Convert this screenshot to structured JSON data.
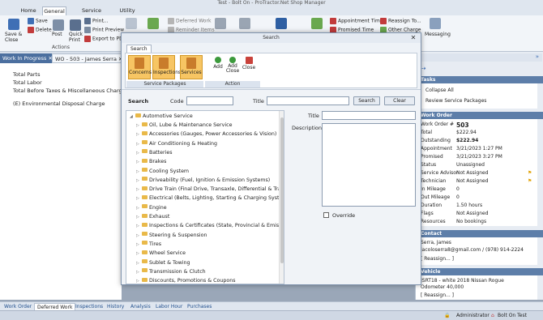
{
  "window": {
    "title": "Test - Bolt On - ProTractor.Net Shop Manager"
  },
  "ribbon": {
    "tabs": [
      "Home",
      "General",
      "Service Package",
      "Utility"
    ],
    "active_tab": "General",
    "items": {
      "save": "Save",
      "delete": "Delete",
      "save_close": "Save &\nClose",
      "post": "Post",
      "quick_print": "Quick\nPrint",
      "print": "Print...",
      "print_preview": "Print Preview",
      "export_pdf": "Export to PDF",
      "deferred_work": "Deferred Work",
      "reminder_items": "Reminder Items",
      "appointment_time": "Appointment Time",
      "promised_time": "Promised Time",
      "reassign_to": "Reassign To...",
      "other_charge": "Other Charge",
      "messaging": "Messaging"
    },
    "group_label": "Actions"
  },
  "doc_tabs": [
    "Work In Progress",
    "WO - 503 - James Serra"
  ],
  "left_panel": {
    "lines": [
      "Total Parts",
      "Total Labor",
      "Total Before Taxes & Miscellaneous Charges",
      "(E) Environmental Disposal Charge"
    ]
  },
  "right_panel": {
    "tasks_header": "Tasks",
    "tasks": [
      "Collapse All",
      "Review Service Packages"
    ],
    "work_order_header": "Work Order",
    "work_order": [
      {
        "label": "Work Order #",
        "value": "503"
      },
      {
        "label": "Total",
        "value": "$222.94"
      },
      {
        "label": "Outstanding",
        "value": "$222.94"
      },
      {
        "label": "Appointment",
        "value": "3/21/2023 1:27 PM"
      },
      {
        "label": "Promised",
        "value": "3/21/2023 3:27 PM"
      },
      {
        "label": "Status",
        "value": "Unassigned"
      },
      {
        "label": "Service Advisor",
        "value": "Not Assigned"
      },
      {
        "label": "Technician",
        "value": "Not Assigned"
      },
      {
        "label": "In Mileage",
        "value": "0"
      },
      {
        "label": "Out Mileage",
        "value": "0"
      },
      {
        "label": "Duration",
        "value": "1.50 hours"
      },
      {
        "label": "Flags",
        "value": "Not Assigned"
      },
      {
        "label": "Resources",
        "value": "No bookings"
      }
    ],
    "contact_header": "Contact",
    "contact_name": "Serra, James",
    "contact_info": "jacoloserra8@gmail.com / (978) 914-2224",
    "contact_reassign": "[ Reassign... ]",
    "vehicle_header": "Vehicle",
    "vehicle_desc": "JSRT18 - white 2018 Nissan Rogue",
    "vehicle_odo": "Odometer 40,000",
    "vehicle_reassign": "[ Reassign... ]"
  },
  "bottom_tabs": [
    "Work Order",
    "Deferred Work",
    "Inspections",
    "History",
    "Analysis",
    "Labor Hour",
    "Purchases"
  ],
  "status_bar": {
    "user": "Administrator",
    "shop": "Bolt On Test"
  },
  "modal": {
    "title": "Search",
    "ribbon_tab": "Search",
    "packages_buttons": [
      "Concerns",
      "Inspections",
      "Services"
    ],
    "packages_label": "Service Packages",
    "action_buttons": [
      "Add",
      "Add\nClose",
      "Close"
    ],
    "action_label": "Action",
    "search_label": "Search",
    "code_label": "Code",
    "code_value": "",
    "title_label": "Title",
    "title_value": "",
    "search_btn": "Search",
    "clear_btn": "Clear",
    "tree_root": "Automotive Service",
    "tree_items": [
      "Oil, Lube & Maintenance Service",
      "Accessories (Gauges, Power Accessories & Vision)",
      "Air Conditioning & Heating",
      "Batteries",
      "Brakes",
      "Cooling System",
      "Driveability (Fuel, Ignition & Emission Systems)",
      "Drive Train (Final Drive, Transaxle, Differential & Transfer Ca",
      "Electrical (Belts, Lighting, Starting & Charging Systems)",
      "Engine",
      "Exhaust",
      "Inspections & Certificates (State, Provincial & Emissions)",
      "Steering & Suspension",
      "Tires",
      "Wheel Service",
      "Sublet & Towing",
      "Transmission & Clutch",
      "Discounts, Promotions & Coupons"
    ],
    "detail_title_label": "Title",
    "detail_desc_label": "Description",
    "override_label": "Override"
  }
}
